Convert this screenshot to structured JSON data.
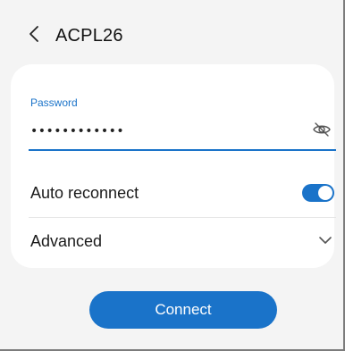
{
  "header": {
    "title": "ACPL26",
    "back_icon": "chevron-left-icon"
  },
  "password": {
    "label": "Password",
    "masked_value": "••••••••••••",
    "visibility_icon": "eye-off-icon"
  },
  "auto_reconnect": {
    "label": "Auto reconnect",
    "enabled": true
  },
  "advanced": {
    "label": "Advanced",
    "icon": "chevron-down-icon"
  },
  "connect_button": {
    "label": "Connect"
  },
  "colors": {
    "accent": "#1a73c9",
    "background": "#f4f4f4",
    "card": "#ffffff"
  }
}
